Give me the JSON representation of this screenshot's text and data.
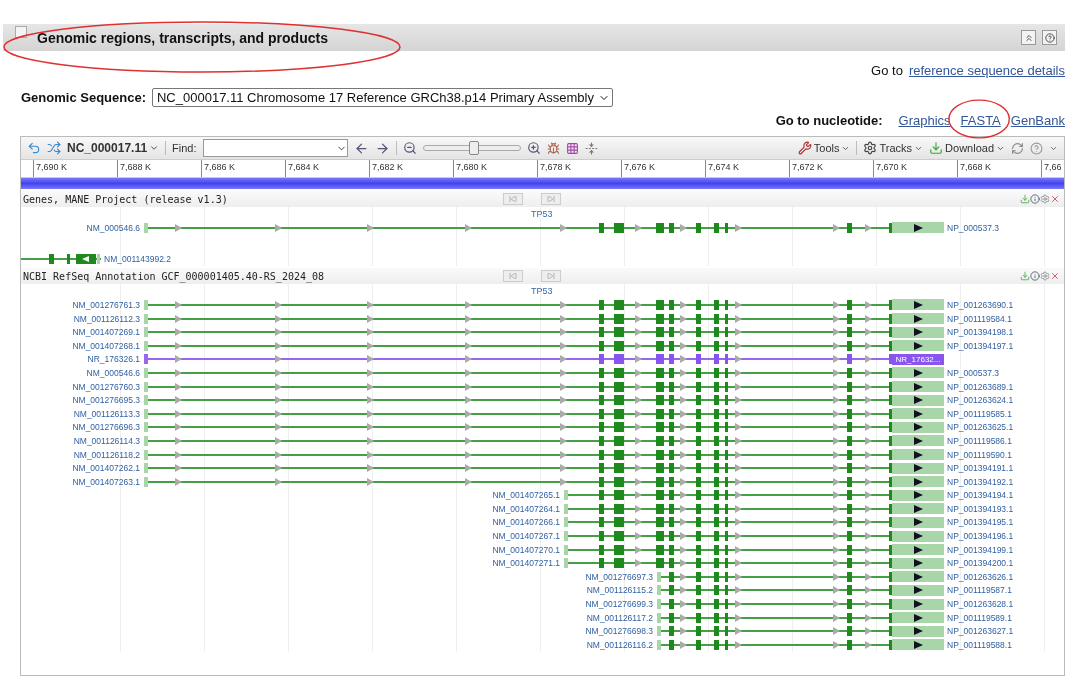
{
  "section": {
    "title": "Genomic regions, transcripts, and products"
  },
  "reference_link": {
    "prefix": "Go to",
    "link": "reference sequence details"
  },
  "genomic_sequence": {
    "label": "Genomic Sequence:",
    "value": "NC_000017.11 Chromosome 17 Reference GRCh38.p14 Primary Assembly"
  },
  "nucleotide_links": {
    "label": "Go to nucleotide:",
    "links": [
      "Graphics",
      "FASTA",
      "GenBank"
    ]
  },
  "viewer": {
    "toolbar": {
      "sequence": "NC_000017.11",
      "find_label": "Find:",
      "zoom": {
        "level": 0.52
      },
      "tools": "Tools",
      "tracks": "Tracks",
      "download": "Download"
    },
    "ruler": [
      "7,690 K",
      "7,688 K",
      "7,686 K",
      "7,684 K",
      "7,682 K",
      "7,680 K",
      "7,678 K",
      "7,676 K",
      "7,674 K",
      "7,672 K",
      "7,670 K",
      "7,668 K",
      "7,66"
    ],
    "tracks": [
      {
        "title": "Genes, MANE Project (release v1.3)",
        "gene": "TP53",
        "rows": [
          {
            "kind": "full",
            "transcript": "NM_000546.6",
            "product": "NP_000537.3"
          },
          {
            "kind": "left-gene",
            "transcript": "NM_001143992.2"
          }
        ]
      },
      {
        "title": "NCBI RefSeq Annotation GCF_000001405.40-RS_2024_08",
        "gene": "TP53",
        "rows": [
          {
            "kind": "full",
            "transcript": "NM_001276761.3",
            "product": "NP_001263690.1"
          },
          {
            "kind": "full",
            "transcript": "NM_001126112.3",
            "product": "NP_001119584.1"
          },
          {
            "kind": "full",
            "transcript": "NM_001407269.1",
            "product": "NP_001394198.1"
          },
          {
            "kind": "full",
            "transcript": "NM_001407268.1",
            "product": "NP_001394197.1"
          },
          {
            "kind": "noncoding",
            "transcript": "NR_176326.1",
            "product": "NR_17632..."
          },
          {
            "kind": "full",
            "transcript": "NM_000546.6",
            "product": "NP_000537.3"
          },
          {
            "kind": "full",
            "transcript": "NM_001276760.3",
            "product": "NP_001263689.1"
          },
          {
            "kind": "full",
            "transcript": "NM_001276695.3",
            "product": "NP_001263624.1"
          },
          {
            "kind": "full",
            "transcript": "NM_001126113.3",
            "product": "NP_001119585.1"
          },
          {
            "kind": "full",
            "transcript": "NM_001276696.3",
            "product": "NP_001263625.1"
          },
          {
            "kind": "full",
            "transcript": "NM_001126114.3",
            "product": "NP_001119586.1"
          },
          {
            "kind": "full",
            "transcript": "NM_001126118.2",
            "product": "NP_001119590.1"
          },
          {
            "kind": "full",
            "transcript": "NM_001407262.1",
            "product": "NP_001394191.1"
          },
          {
            "kind": "full",
            "transcript": "NM_001407263.1",
            "product": "NP_001394192.1"
          },
          {
            "kind": "mid",
            "transcript": "NM_001407265.1",
            "product": "NP_001394194.1"
          },
          {
            "kind": "mid",
            "transcript": "NM_001407264.1",
            "product": "NP_001394193.1"
          },
          {
            "kind": "mid",
            "transcript": "NM_001407266.1",
            "product": "NP_001394195.1"
          },
          {
            "kind": "mid",
            "transcript": "NM_001407267.1",
            "product": "NP_001394196.1"
          },
          {
            "kind": "mid",
            "transcript": "NM_001407270.1",
            "product": "NP_001394199.1"
          },
          {
            "kind": "mid",
            "transcript": "NM_001407271.1",
            "product": "NP_001394200.1"
          },
          {
            "kind": "short",
            "transcript": "NM_001276697.3",
            "product": "NP_001263626.1"
          },
          {
            "kind": "short",
            "transcript": "NM_001126115.2",
            "product": "NP_001119587.1"
          },
          {
            "kind": "short",
            "transcript": "NM_001276699.3",
            "product": "NP_001263628.1"
          },
          {
            "kind": "short",
            "transcript": "NM_001126117.2",
            "product": "NP_001119589.1"
          },
          {
            "kind": "short",
            "transcript": "NM_001276698.3",
            "product": "NP_001263627.1"
          },
          {
            "kind": "short",
            "transcript": "NM_001126116.2",
            "product": "NP_001119588.1"
          }
        ]
      }
    ]
  }
}
